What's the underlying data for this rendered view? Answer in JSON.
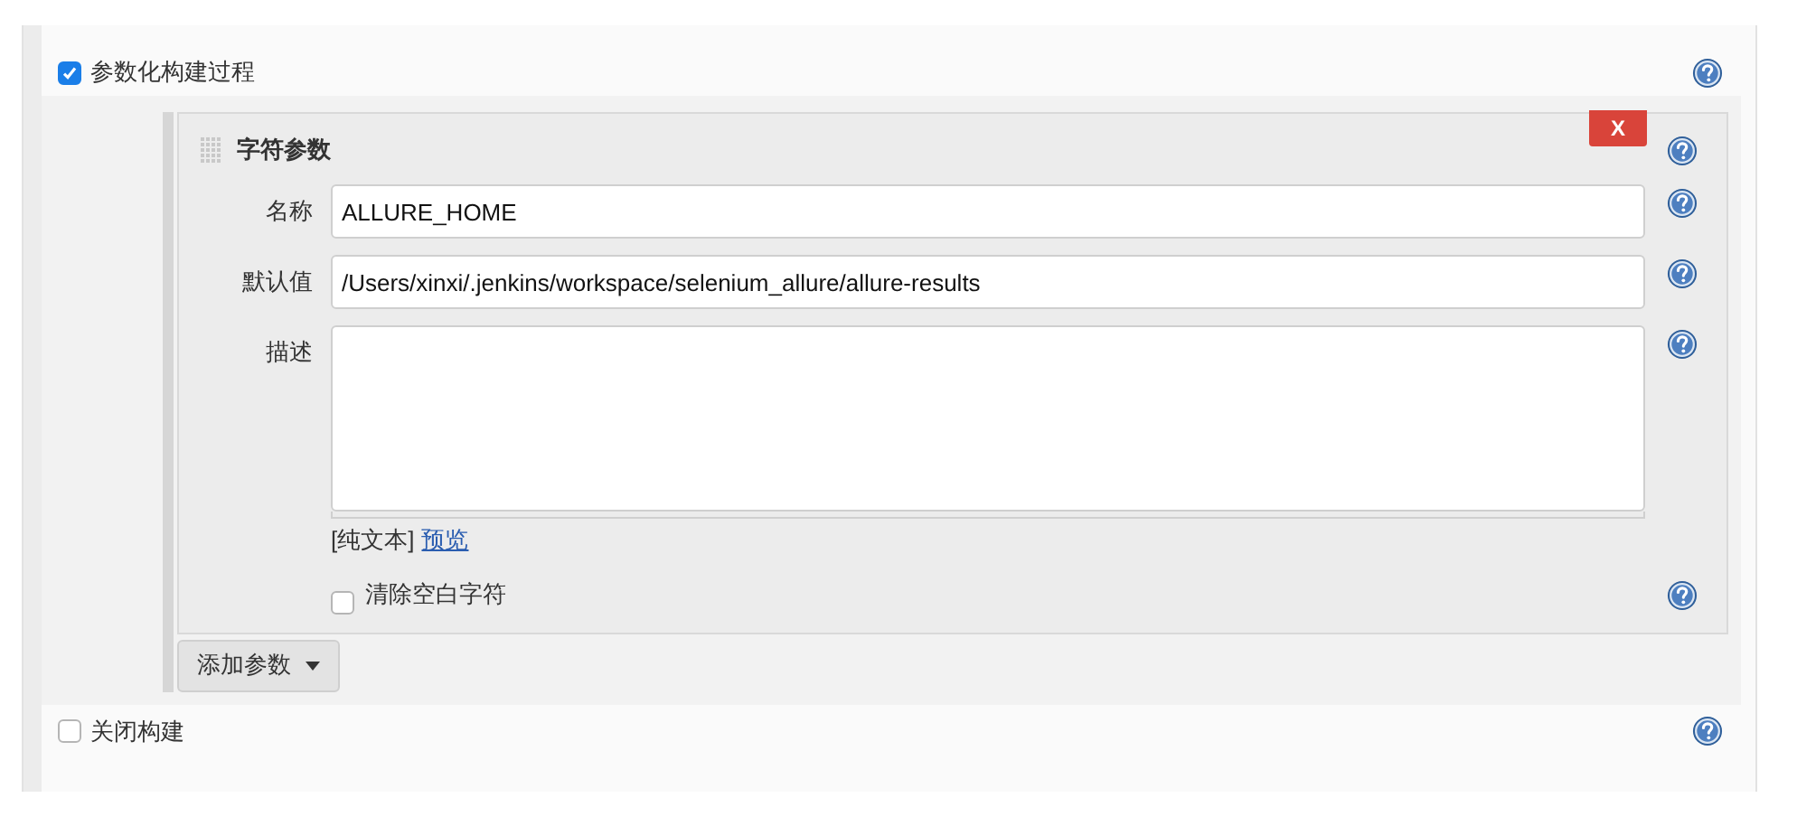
{
  "options_top": [
    {
      "label": "参数化构建过程",
      "checked": true
    }
  ],
  "parameter": {
    "title": "字符参数",
    "delete": "X",
    "fields": [
      {
        "kind": "input",
        "label": "名称",
        "value": "ALLURE_HOME"
      },
      {
        "kind": "input",
        "label": "默认值",
        "value": "/Users/xinxi/.jenkins/workspace/selenium_allure/allure-results"
      },
      {
        "kind": "textarea",
        "label": "描述"
      }
    ],
    "format": "[纯文本]",
    "preview": "预览",
    "trim": {
      "label": "清除空白字符",
      "checked": false
    }
  },
  "add_button": "添加参数",
  "options_bottom": [
    {
      "label": "关闭构建",
      "checked": false
    }
  ]
}
